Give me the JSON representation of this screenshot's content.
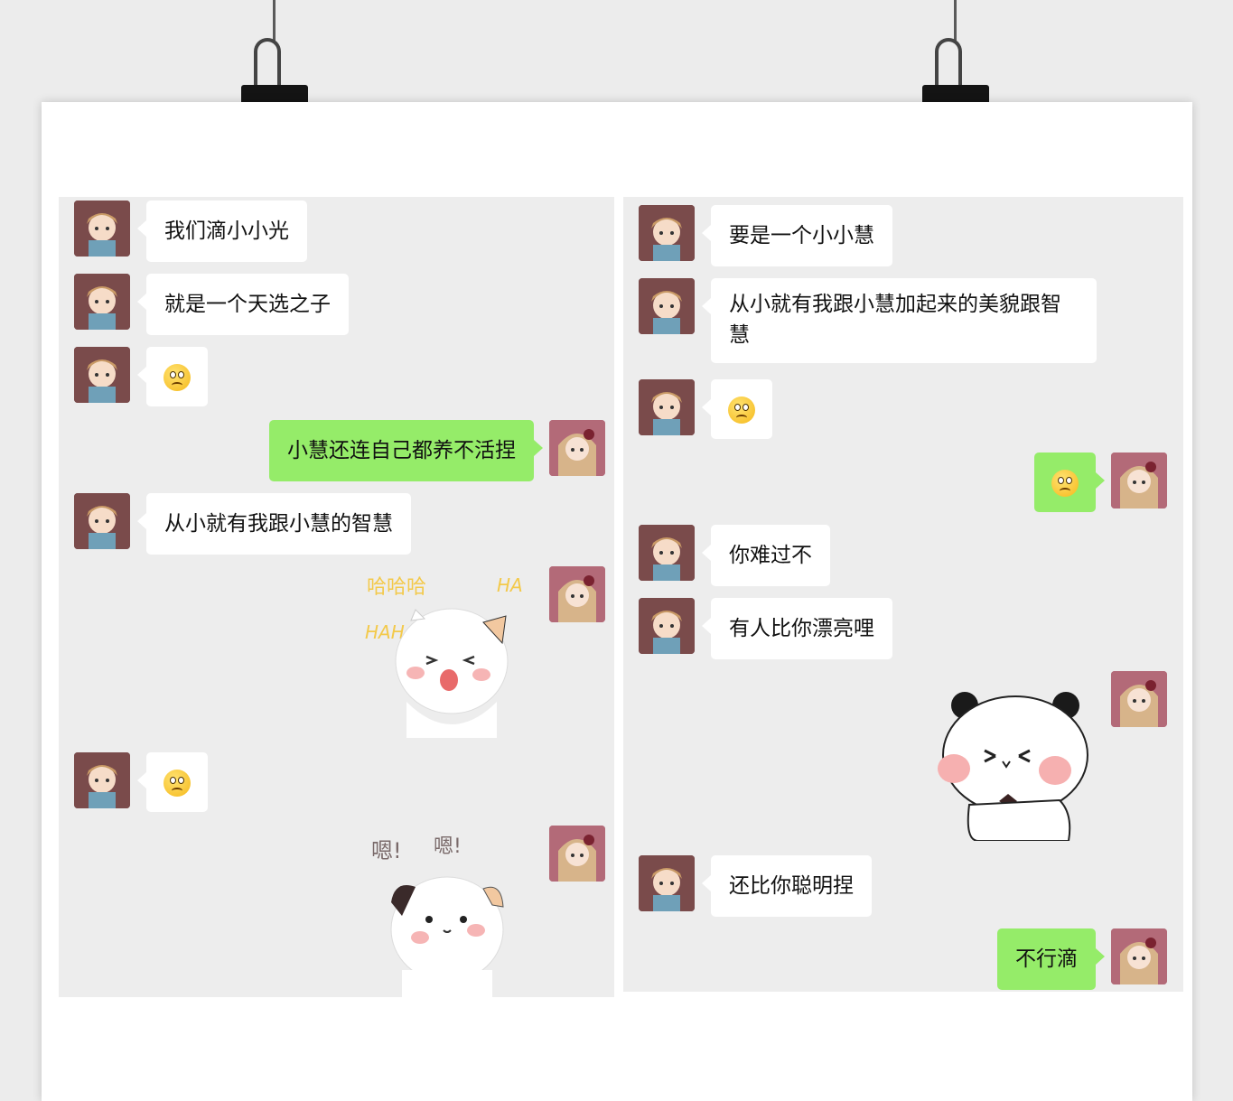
{
  "panel_left": {
    "messages": [
      {
        "side": "left",
        "text": "我们滴小小光"
      },
      {
        "side": "left",
        "text": "就是一个天选之子"
      },
      {
        "side": "left",
        "emoji": "confused-emoji"
      },
      {
        "side": "right",
        "text": "小慧还连自己都养不活捏"
      },
      {
        "side": "left",
        "text": "从小就有我跟小慧的智慧"
      },
      {
        "side": "right",
        "sticker": "laughing-cat-sticker",
        "sticker_text": [
          "哈哈哈",
          "HA",
          "HAH"
        ]
      },
      {
        "side": "left",
        "emoji": "confused-emoji"
      },
      {
        "side": "right",
        "sticker": "nodding-cat-sticker",
        "sticker_text": [
          "嗯!",
          "嗯!"
        ]
      }
    ]
  },
  "panel_right": {
    "messages": [
      {
        "side": "left",
        "text": "要是一个小小慧"
      },
      {
        "side": "left",
        "text": "从小就有我跟小慧加起来的美貌跟智慧"
      },
      {
        "side": "left",
        "emoji": "confused-emoji"
      },
      {
        "side": "right",
        "emoji": "confused-emoji"
      },
      {
        "side": "left",
        "text": "你难过不"
      },
      {
        "side": "left",
        "text": "有人比你漂亮哩"
      },
      {
        "side": "right",
        "sticker": "crying-panda-sticker"
      },
      {
        "side": "left",
        "text": "还比你聪明捏"
      },
      {
        "side": "right",
        "text": "不行滴"
      }
    ]
  },
  "colors": {
    "chat_background": "#ededed",
    "outgoing_bubble": "#95ec69",
    "incoming_bubble": "#ffffff"
  }
}
